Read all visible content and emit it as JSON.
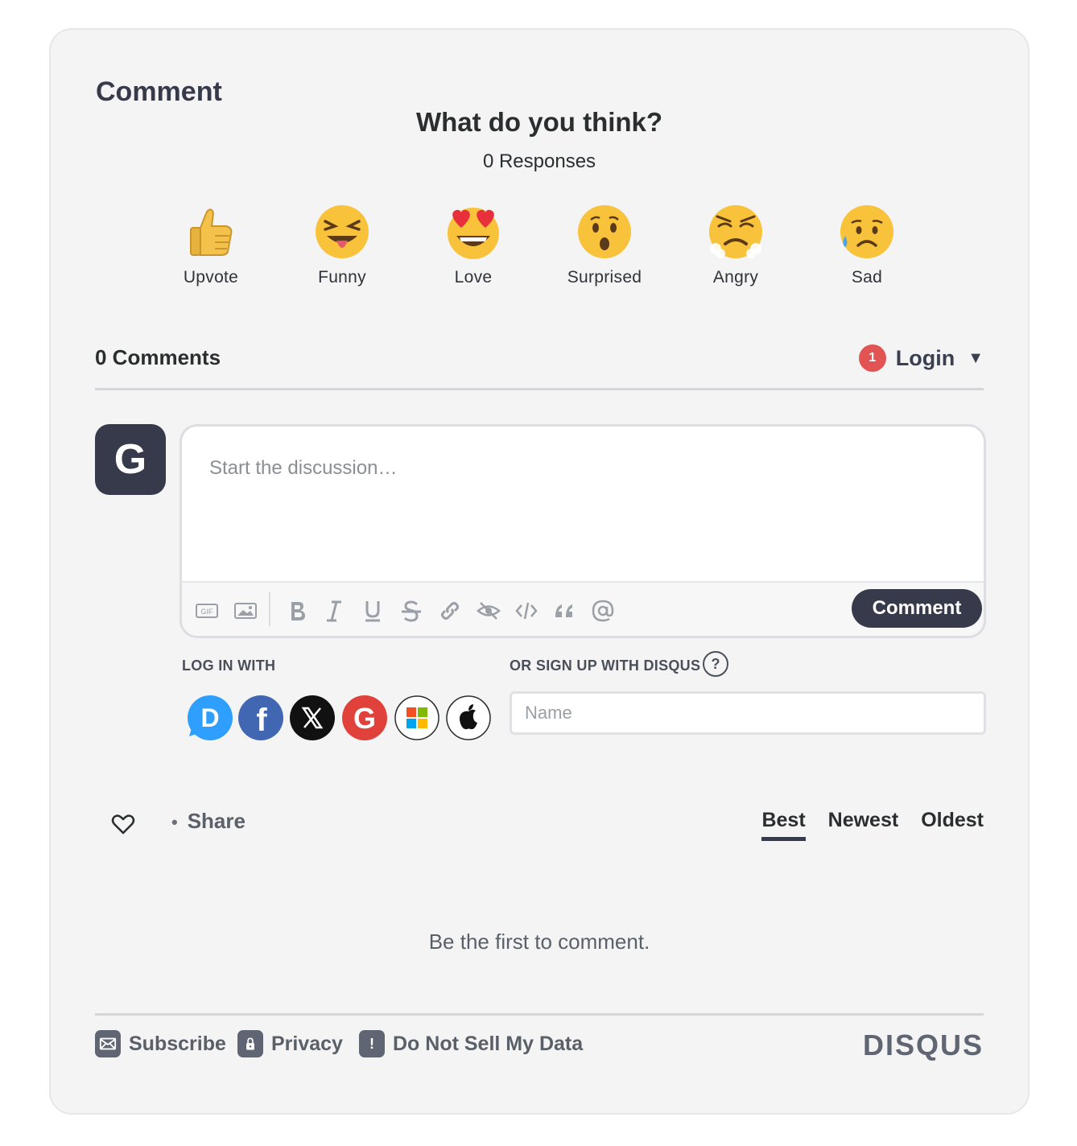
{
  "section_title": "Comment",
  "reactions": {
    "question": "What do you think?",
    "responses": "0 Responses",
    "items": [
      {
        "label": "Upvote",
        "icon": "thumbs-up-icon"
      },
      {
        "label": "Funny",
        "icon": "laughing-face-icon"
      },
      {
        "label": "Love",
        "icon": "heart-eyes-face-icon"
      },
      {
        "label": "Surprised",
        "icon": "surprised-face-icon"
      },
      {
        "label": "Angry",
        "icon": "angry-face-icon"
      },
      {
        "label": "Sad",
        "icon": "sad-face-icon"
      }
    ]
  },
  "comments": {
    "count": "0 Comments",
    "login_badge": "1",
    "login_label": "Login",
    "caret": "▼"
  },
  "avatar_letter": "G",
  "editor": {
    "placeholder": "Start the discussion…",
    "gif_label": "GIF",
    "submit_label": "Comment"
  },
  "auth": {
    "login_with": "LOG IN WITH",
    "signup_with": "OR SIGN UP WITH DISQUS",
    "help": "?",
    "name_placeholder": "Name",
    "disqus_letter": "D",
    "facebook_letter": "f",
    "google_letter": "G"
  },
  "actions": {
    "share_dot": "•",
    "share_label": "Share",
    "sort_tabs": [
      "Best",
      "Newest",
      "Oldest"
    ]
  },
  "empty_message": "Be the first to comment.",
  "footer": {
    "subscribe": "Subscribe",
    "privacy": "Privacy",
    "do_not_sell": "Do Not Sell My Data",
    "do_not_sell_icon": "!",
    "brand": "DISQUS"
  },
  "colors": {
    "dark": "#363a4a",
    "badge": "#e25453",
    "disqus_blue": "#2e9fff",
    "facebook": "#4267b2",
    "google": "#e0413a"
  }
}
